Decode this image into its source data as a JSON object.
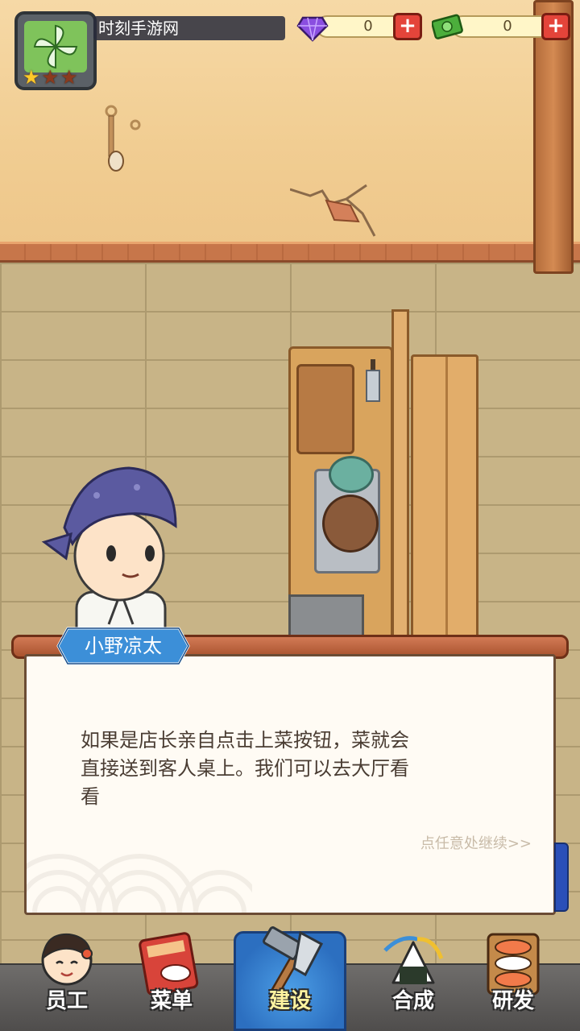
{
  "header": {
    "site_name": "时刻手游网",
    "rating": {
      "filled": 1,
      "total": 3
    }
  },
  "currencies": [
    {
      "name": "gem",
      "value": "0",
      "icon": "purple-gem-icon",
      "color": "#8a4ee0"
    },
    {
      "name": "cash",
      "value": "0",
      "icon": "cash-icon",
      "color": "#4cae3c"
    }
  ],
  "dialog": {
    "speaker": "小野凉太",
    "lines": [
      "如果是店长亲自点击上菜按钮，菜就会",
      "直接送到客人桌上。我们可以去大厅看",
      "看"
    ],
    "continue_hint": "点任意处继续>>"
  },
  "nav": {
    "items": [
      {
        "label": "员工",
        "icon": "chef-avatar-icon"
      },
      {
        "label": "菜单",
        "icon": "menu-book-icon"
      },
      {
        "label": "建设",
        "icon": "hammer-saw-icon",
        "active": true
      },
      {
        "label": "合成",
        "icon": "rice-ball-merge-icon"
      },
      {
        "label": "研发",
        "icon": "sushi-tray-icon"
      }
    ]
  },
  "colors": {
    "accent_active": "#2c6fc0",
    "dialog_text": "#4a3d33",
    "name_tag": "#3c8fd8",
    "plus_button": "#e4443a"
  }
}
